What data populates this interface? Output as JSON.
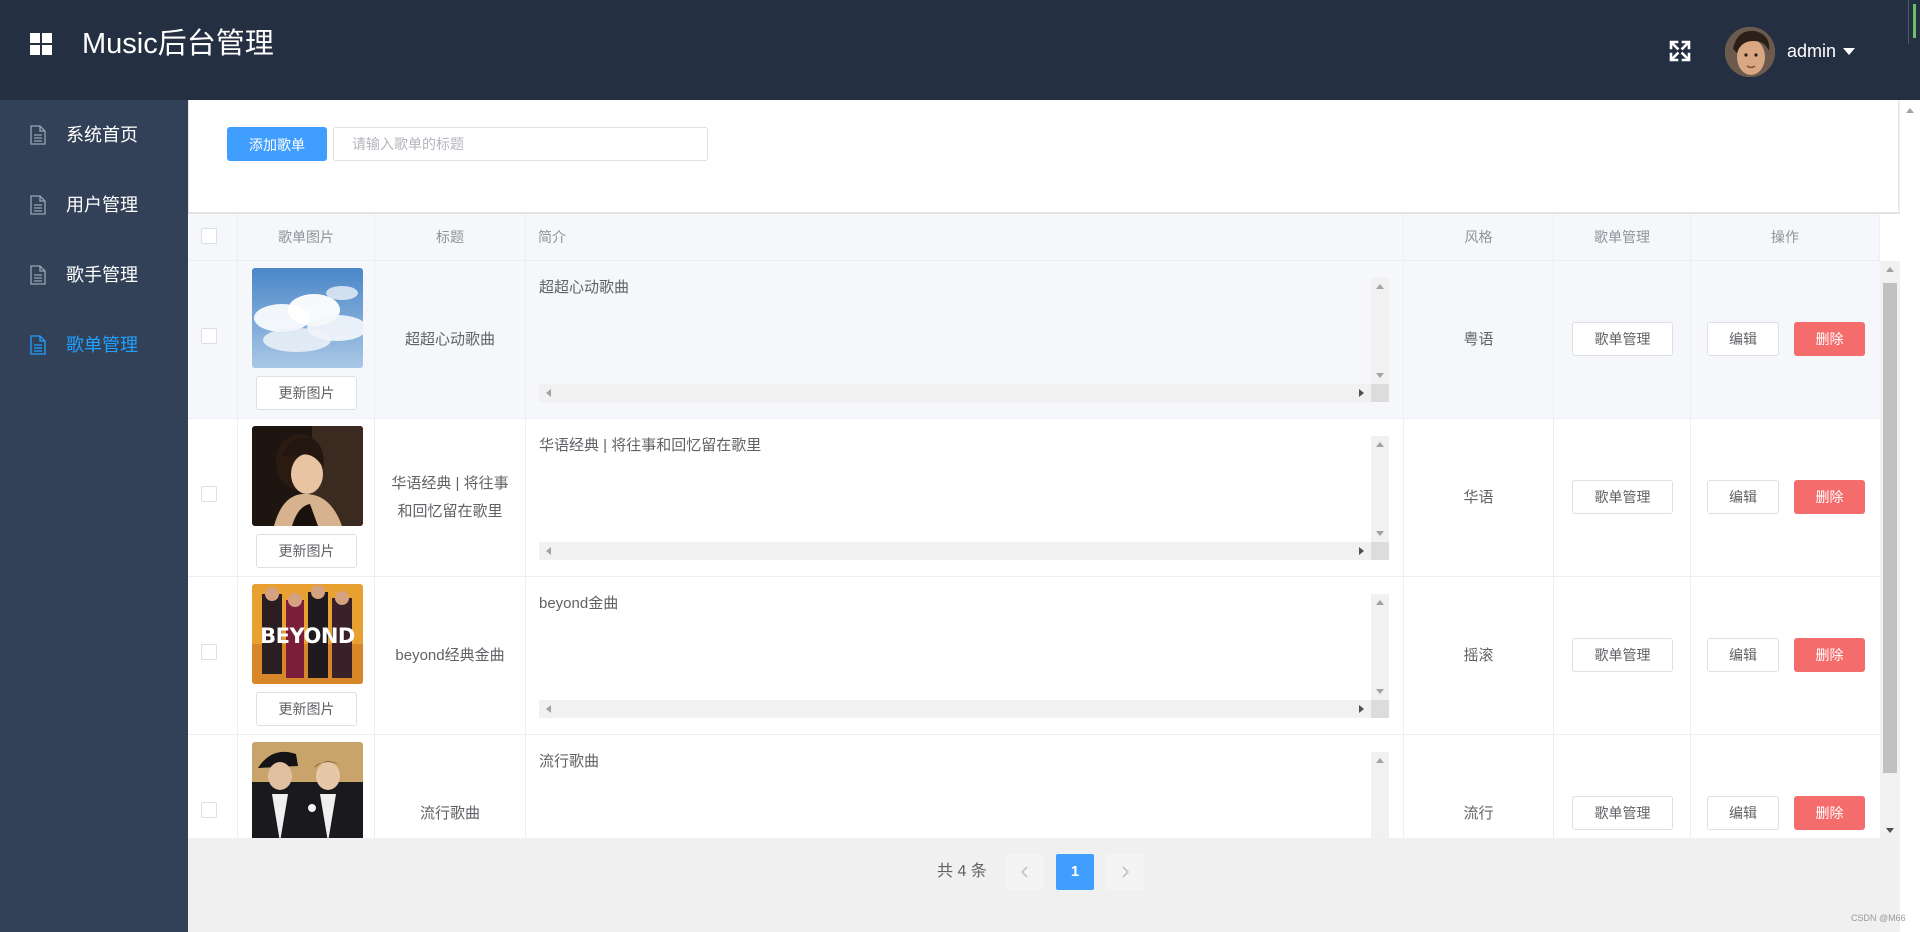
{
  "header": {
    "title": "Music后台管理",
    "username": "admin"
  },
  "sidebar": {
    "items": [
      {
        "label": "系统首页",
        "active": false
      },
      {
        "label": "用户管理",
        "active": false
      },
      {
        "label": "歌手管理",
        "active": false
      },
      {
        "label": "歌单管理",
        "active": true
      }
    ]
  },
  "toolbar": {
    "add_label": "添加歌单",
    "search_placeholder": "请输入歌单的标题",
    "search_value": ""
  },
  "table": {
    "columns": [
      "歌单图片",
      "标题",
      "简介",
      "风格",
      "歌单管理",
      "操作"
    ],
    "rows": [
      {
        "title": "超超心动歌曲",
        "intro": "超超心动歌曲",
        "style": "粤语",
        "cover": "sky-clouds"
      },
      {
        "title": "华语经典 | 将往事和回忆留在歌里",
        "intro": "华语经典 | 将往事和回忆留在歌里",
        "style": "华语",
        "cover": "portrait-woman"
      },
      {
        "title": "beyond经典金曲",
        "intro": "beyond金曲",
        "style": "摇滚",
        "cover": "beyond-band"
      },
      {
        "title": "流行歌曲",
        "intro": "流行歌曲",
        "style": "流行",
        "cover": "two-men-suits"
      }
    ],
    "update_cover_label": "更新图片",
    "manage_label": "歌单管理",
    "edit_label": "编辑",
    "delete_label": "删除"
  },
  "pagination": {
    "total_text": "共 4 条",
    "current_page": "1"
  },
  "watermark": "CSDN @M66",
  "colors": {
    "header_bg": "#242f42",
    "sidebar_bg": "#324157",
    "primary": "#409eff",
    "danger": "#f56c6c",
    "active_menu": "#20a0ff"
  }
}
